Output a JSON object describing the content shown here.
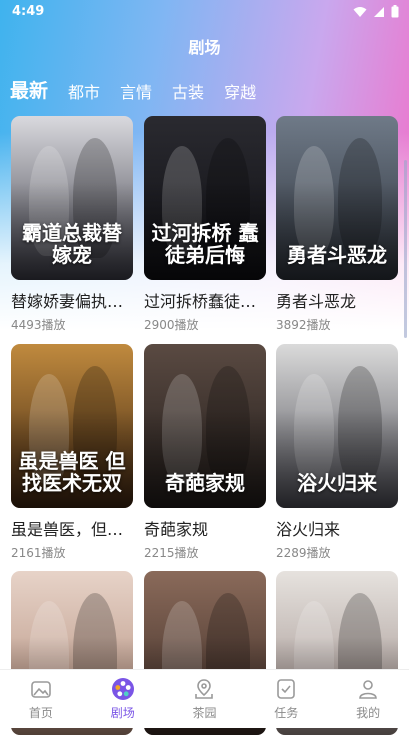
{
  "status_bar": {
    "time": "4:49"
  },
  "header": {
    "title": "剧场"
  },
  "tabs": [
    {
      "label": "最新",
      "active": true
    },
    {
      "label": "都市",
      "active": false
    },
    {
      "label": "言情",
      "active": false
    },
    {
      "label": "古装",
      "active": false
    },
    {
      "label": "穿越",
      "active": false
    }
  ],
  "cards": [
    {
      "title": "替嫁娇妻偏执…",
      "plays": "4493播放",
      "poster_text": "霸道总裁替嫁宠",
      "colors": [
        "#d9d9de",
        "#3a3a44"
      ]
    },
    {
      "title": "过河拆桥蠢徒…",
      "plays": "2900播放",
      "poster_text": "过河拆桥 蠢徒弟后悔",
      "colors": [
        "#2a2a30",
        "#0e0e12"
      ]
    },
    {
      "title": "勇者斗恶龙",
      "plays": "3892播放",
      "poster_text": "勇者斗恶龙",
      "colors": [
        "#6f7a88",
        "#2b3038"
      ]
    },
    {
      "title": "虽是兽医，但…",
      "plays": "2161播放",
      "poster_text": "虽是兽医 但找医术无双",
      "colors": [
        "#c08a3e",
        "#3a2210"
      ]
    },
    {
      "title": "奇葩家规",
      "plays": "2215播放",
      "poster_text": "奇葩家规",
      "colors": [
        "#5a4a42",
        "#1f1a18"
      ]
    },
    {
      "title": "浴火归来",
      "plays": "2289播放",
      "poster_text": "浴火归来",
      "colors": [
        "#dadada",
        "#4a4a52"
      ]
    },
    {
      "title": "",
      "plays": "",
      "poster_text": "",
      "colors": [
        "#e7d3c8",
        "#b08a78"
      ]
    },
    {
      "title": "",
      "plays": "",
      "poster_text": "",
      "colors": [
        "#8a6a5a",
        "#3a2a24"
      ]
    },
    {
      "title": "",
      "plays": "",
      "poster_text": "",
      "colors": [
        "#e6e2de",
        "#9a8a86"
      ]
    }
  ],
  "bottom_nav": [
    {
      "label": "首页",
      "icon": "home-icon",
      "active": false
    },
    {
      "label": "剧场",
      "icon": "film-reel-icon",
      "active": true
    },
    {
      "label": "茶园",
      "icon": "location-pin-icon",
      "active": false
    },
    {
      "label": "任务",
      "icon": "checklist-icon",
      "active": false
    },
    {
      "label": "我的",
      "icon": "person-icon",
      "active": false
    }
  ],
  "accent_color": "#7a55e6"
}
